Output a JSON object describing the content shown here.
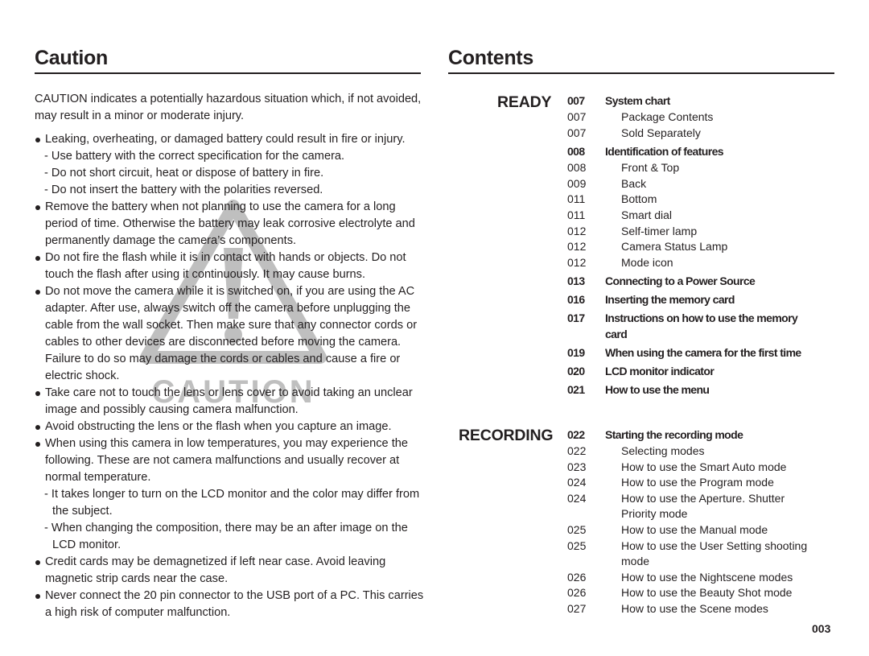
{
  "caution": {
    "title": "Caution",
    "intro": "CAUTION indicates a potentially hazardous situation which, if not avoided, may result in a minor or moderate injury.",
    "watermark_text": "CAUTION",
    "watermark_icon": "warning-triangle-icon",
    "items": [
      {
        "text": "Leaking, overheating, or damaged battery could result in fire or injury.",
        "subs": [
          "- Use battery with the correct specification for the camera.",
          "- Do not short circuit, heat or dispose of battery in fire.",
          "- Do not insert the battery with the polarities reversed."
        ]
      },
      {
        "text": "Remove the battery when not planning to use the camera for a long period of time. Otherwise the battery may leak corrosive electrolyte and permanently damage the camera’s components.",
        "subs": []
      },
      {
        "text": "Do not fire the flash while it is in contact with hands or objects. Do not touch the flash after using it continuously. It may cause burns.",
        "subs": []
      },
      {
        "text": "Do not move the camera while it is switched on, if you are using the AC adapter. After use, always switch off the camera before unplugging the cable from the wall socket. Then make sure that any connector cords or cables to other devices are disconnected before moving the camera. Failure to do so may damage the cords or cables and cause a fire or electric shock.",
        "subs": []
      },
      {
        "text": "Take care not to touch the lens or lens cover to avoid taking an unclear image and possibly causing camera malfunction.",
        "subs": []
      },
      {
        "text": "Avoid obstructing the lens or the flash when you capture an image.",
        "subs": []
      },
      {
        "text": "When using this camera in low temperatures, you may experience the following. These are not camera malfunctions and usually recover at normal temperature.",
        "subs": [
          "- It takes longer to turn on the LCD monitor and the color may differ from the subject.",
          "- When changing the composition, there may be an after image on the LCD monitor."
        ]
      },
      {
        "text": "Credit cards may be demagnetized if left near case. Avoid leaving magnetic strip cards near the case.",
        "subs": []
      },
      {
        "text": "Never connect the 20 pin connector to the USB port of a PC. This carries a high risk of computer malfunction.",
        "subs": []
      }
    ]
  },
  "contents": {
    "title": "Contents",
    "sections": [
      {
        "label": "READY",
        "entries": [
          {
            "page": "007",
            "title": "System chart",
            "level": "main"
          },
          {
            "page": "007",
            "title": "Package Contents",
            "level": "child"
          },
          {
            "page": "007",
            "title": "Sold Separately",
            "level": "child"
          },
          {
            "page": "008",
            "title": "Identification of features",
            "level": "main"
          },
          {
            "page": "008",
            "title": "Front & Top",
            "level": "child"
          },
          {
            "page": "009",
            "title": "Back",
            "level": "child"
          },
          {
            "page": "011",
            "title": "Bottom",
            "level": "child"
          },
          {
            "page": "011",
            "title": "Smart dial",
            "level": "child"
          },
          {
            "page": "012",
            "title": "Self-timer lamp",
            "level": "child"
          },
          {
            "page": "012",
            "title": "Camera Status Lamp",
            "level": "child"
          },
          {
            "page": "012",
            "title": "Mode icon",
            "level": "child"
          },
          {
            "page": "013",
            "title": "Connecting to a Power Source",
            "level": "main"
          },
          {
            "page": "016",
            "title": "Inserting the memory card",
            "level": "main"
          },
          {
            "page": "017",
            "title": "Instructions on how to use the memory card",
            "level": "main"
          },
          {
            "page": "019",
            "title": "When using the camera for the first time",
            "level": "main"
          },
          {
            "page": "020",
            "title": "LCD monitor indicator",
            "level": "main"
          },
          {
            "page": "021",
            "title": "How to use the menu",
            "level": "main"
          }
        ]
      },
      {
        "label": "RECORDING",
        "entries": [
          {
            "page": "022",
            "title": "Starting the recording mode",
            "level": "main"
          },
          {
            "page": "022",
            "title": "Selecting modes",
            "level": "child"
          },
          {
            "page": "023",
            "title": "How to use the Smart Auto mode",
            "level": "child"
          },
          {
            "page": "024",
            "title": "How to use the Program mode",
            "level": "child"
          },
          {
            "page": "024",
            "title": "How to use the Aperture. Shutter Priority mode",
            "level": "child"
          },
          {
            "page": "025",
            "title": "How to use the Manual mode",
            "level": "child"
          },
          {
            "page": "025",
            "title": "How to use the User Setting shooting mode",
            "level": "child"
          },
          {
            "page": "026",
            "title": "How to use the Nightscene modes",
            "level": "child"
          },
          {
            "page": "026",
            "title": "How to use the Beauty Shot mode",
            "level": "child"
          },
          {
            "page": "027",
            "title": "How to use the Scene modes",
            "level": "child"
          }
        ]
      }
    ]
  },
  "page_number": "003"
}
